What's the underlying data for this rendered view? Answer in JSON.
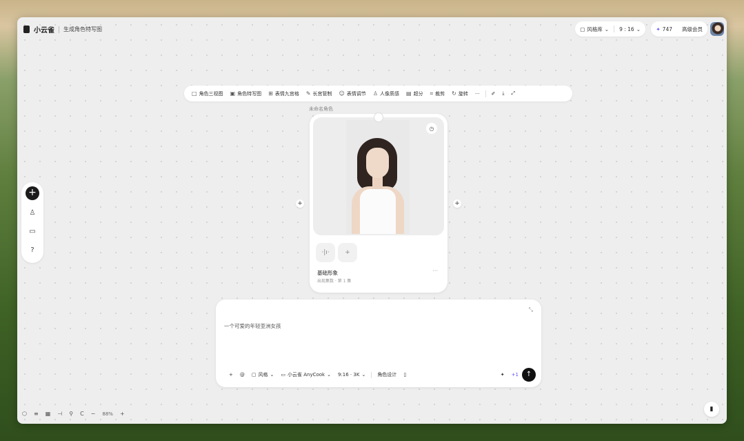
{
  "header": {
    "app_name": "小云雀",
    "page_title": "生成角色特写图",
    "style_library": "风格库",
    "ratio": "9 : 16",
    "credits": "747",
    "membership": "高级会员"
  },
  "toolbar": {
    "items": [
      {
        "icon": "□",
        "label": "角色三视图"
      },
      {
        "icon": "▣",
        "label": "角色特写图"
      },
      {
        "icon": "⊞",
        "label": "表情九宫格"
      },
      {
        "icon": "✎",
        "label": "长宫管制"
      },
      {
        "icon": "☺",
        "label": "表情调节"
      },
      {
        "icon": "♙",
        "label": "人像质感"
      },
      {
        "icon": "▤",
        "label": "超分"
      },
      {
        "icon": "⌗",
        "label": "裁剪"
      },
      {
        "icon": "↻",
        "label": "旋转"
      }
    ],
    "more": "···",
    "annotate_icon": "✐",
    "download_icon": "⤓",
    "fullscreen_icon": "⤢"
  },
  "card": {
    "title": "未命名角色",
    "name": "基础形象",
    "meta": "出现集数 · 第 1 集",
    "more": "···",
    "history_icon": "◷",
    "audio_icon": "·|ı·",
    "add_icon": "+"
  },
  "canvas": {
    "plus": "+"
  },
  "leftbar": {
    "add": "+",
    "icons": [
      "♙",
      "▭",
      "?"
    ]
  },
  "prompt": {
    "text": "一个可爱的年轻亚洲女孩",
    "expand_icon": "⤡",
    "add": "+",
    "mention": "@",
    "style": "风格",
    "model": "小云雀 AnyCook",
    "ratio_res": "9:16 · 3K",
    "role_design": "角色设计",
    "book_icon": "▯",
    "magic_icon": "✦",
    "count": "+1",
    "send": "↑"
  },
  "bottom": {
    "icons": [
      "⬡",
      "≡",
      "▦",
      "⊣",
      "⚲",
      "C"
    ],
    "zoom_out": "−",
    "zoom": "88%",
    "zoom_in": "+"
  },
  "fab_icon": "▮",
  "colors": {
    "accent": "#111111",
    "canvas": "#eeeeee"
  }
}
